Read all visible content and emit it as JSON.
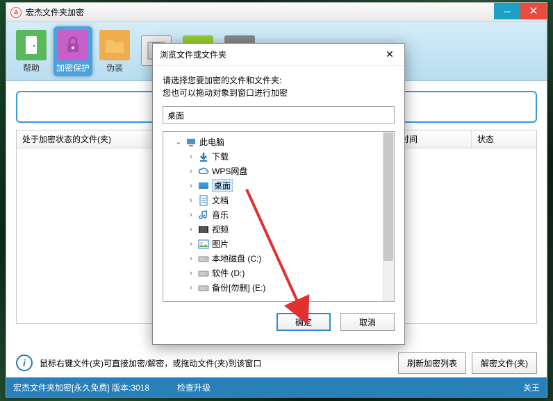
{
  "window": {
    "title": "宏杰文件夹加密"
  },
  "toolbar": {
    "items": [
      {
        "label": "帮助"
      },
      {
        "label": "加密保护"
      },
      {
        "label": "伪装"
      }
    ]
  },
  "searchbar": {},
  "list": {
    "columns": {
      "c0": "处于加密状态的文件(夹)",
      "c1": "时间",
      "c2": "状态"
    }
  },
  "footer": {
    "tip": "鼠标右键文件(夹)可直接加密/解密，或拖动文件(夹)到该窗口",
    "refresh": "刷新加密列表",
    "decrypt": "解密文件(夹)"
  },
  "status": {
    "app": "宏杰文件夹加密[永久免费]  版本:3018",
    "update": "检查升级",
    "right": "关王"
  },
  "dialog": {
    "title": "浏览文件或文件夹",
    "msg1": "请选择您要加密的文件和文件夹:",
    "msg2": "您也可以拖动对象到窗口进行加密",
    "input_value": "桌面",
    "tree": [
      {
        "depth": 0,
        "exp": "v",
        "icon": "pc",
        "label": "此电脑",
        "sel": false
      },
      {
        "depth": 1,
        "exp": ">",
        "icon": "dl",
        "label": "下载",
        "sel": false
      },
      {
        "depth": 1,
        "exp": ">",
        "icon": "cloud",
        "label": "WPS网盘",
        "sel": false
      },
      {
        "depth": 1,
        "exp": ">",
        "icon": "desk",
        "label": "桌面",
        "sel": true
      },
      {
        "depth": 1,
        "exp": ">",
        "icon": "doc",
        "label": "文档",
        "sel": false
      },
      {
        "depth": 1,
        "exp": ">",
        "icon": "music",
        "label": "音乐",
        "sel": false
      },
      {
        "depth": 1,
        "exp": ">",
        "icon": "video",
        "label": "视频",
        "sel": false
      },
      {
        "depth": 1,
        "exp": ">",
        "icon": "pic",
        "label": "图片",
        "sel": false
      },
      {
        "depth": 1,
        "exp": ">",
        "icon": "disk",
        "label": "本地磁盘 (C:)",
        "sel": false
      },
      {
        "depth": 1,
        "exp": ">",
        "icon": "disk",
        "label": "软件 (D:)",
        "sel": false
      },
      {
        "depth": 1,
        "exp": ">",
        "icon": "disk",
        "label": "备份[勿删] (E:)",
        "sel": false
      }
    ],
    "ok": "确定",
    "cancel": "取消"
  }
}
